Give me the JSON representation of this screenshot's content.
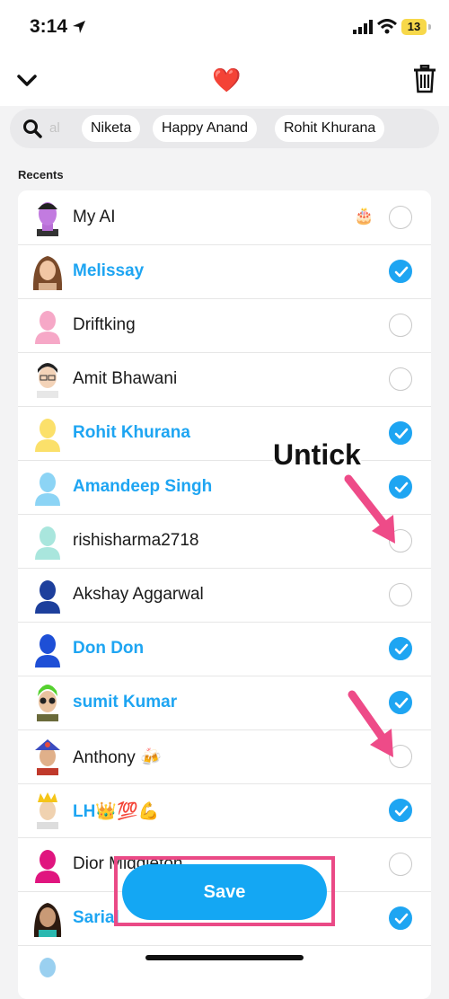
{
  "status_bar": {
    "time": "3:14",
    "battery": "13"
  },
  "header": {
    "title_emoji": "❤️"
  },
  "search": {
    "query_partial": "al",
    "chips": [
      "Niketa",
      "Happy Anand",
      "Rohit Khurana"
    ]
  },
  "section_label": "Recents",
  "contacts": [
    {
      "name": "My AI",
      "selected": false,
      "badge": "🎂"
    },
    {
      "name": "Melissay",
      "selected": true
    },
    {
      "name": "Driftking",
      "selected": false
    },
    {
      "name": "Amit Bhawani",
      "selected": false
    },
    {
      "name": "Rohit Khurana",
      "selected": true
    },
    {
      "name": "Amandeep Singh",
      "selected": true
    },
    {
      "name": "rishisharma2718",
      "selected": false
    },
    {
      "name": "Akshay Aggarwal",
      "selected": false
    },
    {
      "name": "Don Don",
      "selected": true
    },
    {
      "name": "sumit Kumar",
      "selected": true
    },
    {
      "name": "Anthony 🍻",
      "selected": false
    },
    {
      "name": "LH👑💯💪",
      "selected": true
    },
    {
      "name": "Dior Middleton",
      "selected": false
    },
    {
      "name": "Sarial",
      "selected": true
    }
  ],
  "annotation": {
    "label": "Untick"
  },
  "save_button": {
    "label": "Save"
  },
  "colors": {
    "accent": "#1ea5f2",
    "highlight": "#ea4a86",
    "arrow": "#ee4b88"
  }
}
